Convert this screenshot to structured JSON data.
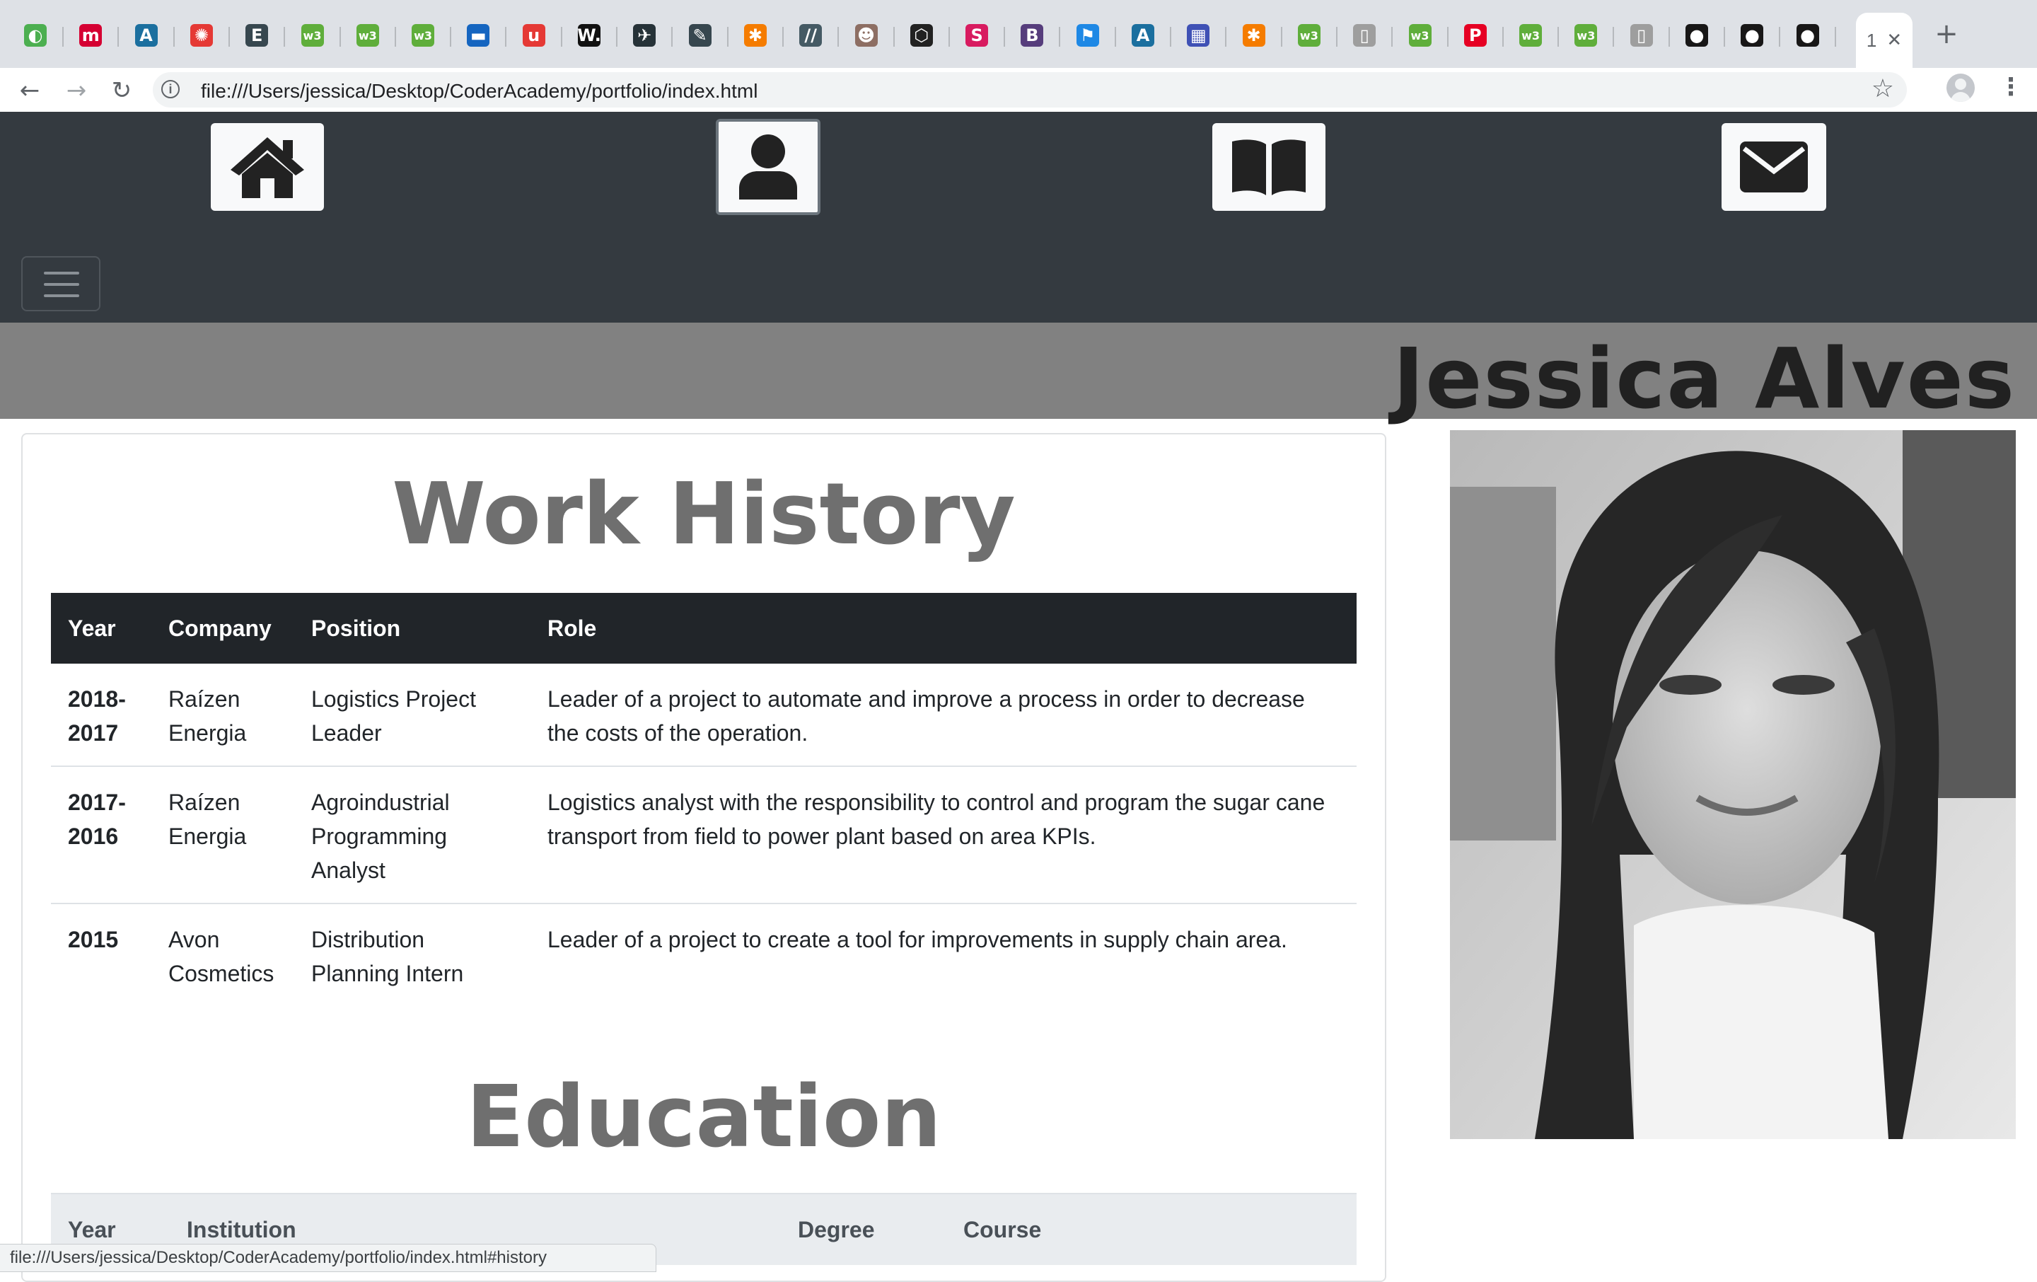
{
  "browser": {
    "tabs": [
      {
        "icon": "chrome-icon",
        "color": "#4caf50",
        "glyph": "◐"
      },
      {
        "icon": "m-logo-icon",
        "color": "#d50032",
        "glyph": "m"
      },
      {
        "icon": "a-logo-icon",
        "color": "#1b6f9f",
        "glyph": "A"
      },
      {
        "icon": "wheel-icon",
        "color": "#e53935",
        "glyph": "✺"
      },
      {
        "icon": "terminal-icon",
        "color": "#37474f",
        "glyph": "E"
      },
      {
        "icon": "w3-icon",
        "color": "#5fae3b",
        "glyph": "w3"
      },
      {
        "icon": "w3-icon",
        "color": "#5fae3b",
        "glyph": "w3"
      },
      {
        "icon": "w3-icon",
        "color": "#5fae3b",
        "glyph": "w3"
      },
      {
        "icon": "chat-icon",
        "color": "#1565c0",
        "glyph": "▬"
      },
      {
        "icon": "u-logo-icon",
        "color": "#e53935",
        "glyph": "u"
      },
      {
        "icon": "w-logo-icon",
        "color": "#111111",
        "glyph": "W."
      },
      {
        "icon": "bird-icon",
        "color": "#263238",
        "glyph": "✈"
      },
      {
        "icon": "pencil-icon",
        "color": "#37474f",
        "glyph": "✎"
      },
      {
        "icon": "asterisk-icon",
        "color": "#f57c00",
        "glyph": "✱"
      },
      {
        "icon": "slashes-icon",
        "color": "#455a64",
        "glyph": "//"
      },
      {
        "icon": "robot-icon",
        "color": "#8d6e63",
        "glyph": "☻"
      },
      {
        "icon": "codepen-icon",
        "color": "#222222",
        "glyph": "⬡"
      },
      {
        "icon": "s-logo-icon",
        "color": "#d81b60",
        "glyph": "S"
      },
      {
        "icon": "bootstrap-icon",
        "color": "#563d7c",
        "glyph": "B"
      },
      {
        "icon": "flag-icon",
        "color": "#1e88e5",
        "glyph": "⚑"
      },
      {
        "icon": "a-logo-icon",
        "color": "#1b6f9f",
        "glyph": "A"
      },
      {
        "icon": "grid-icon",
        "color": "#3f51b5",
        "glyph": "▦"
      },
      {
        "icon": "asterisk-icon",
        "color": "#f57c00",
        "glyph": "✱"
      },
      {
        "icon": "w3-icon",
        "color": "#5fae3b",
        "glyph": "w3"
      },
      {
        "icon": "file-icon",
        "color": "#9e9e9e",
        "glyph": "▯"
      },
      {
        "icon": "w3-icon",
        "color": "#5fae3b",
        "glyph": "w3"
      },
      {
        "icon": "pinterest-icon",
        "color": "#e60023",
        "glyph": "P"
      },
      {
        "icon": "w3-icon",
        "color": "#5fae3b",
        "glyph": "w3"
      },
      {
        "icon": "w3-icon",
        "color": "#5fae3b",
        "glyph": "w3"
      },
      {
        "icon": "file-icon",
        "color": "#9e9e9e",
        "glyph": "▯"
      },
      {
        "icon": "github-icon",
        "color": "#181717",
        "glyph": "●"
      },
      {
        "icon": "github-icon",
        "color": "#181717",
        "glyph": "●"
      },
      {
        "icon": "github-icon",
        "color": "#181717",
        "glyph": "●"
      }
    ],
    "active_tab_title": "1",
    "active_tab_close": "✕",
    "new_tab": "+",
    "back": "←",
    "forward": "→",
    "reload": "↻",
    "info": "i",
    "url": "file:///Users/jessica/Desktop/CoderAcademy/portfolio/index.html",
    "bookmark": "☆",
    "menu": "⋮",
    "status_url": "file:///Users/jessica/Desktop/CoderAcademy/portfolio/index.html#history"
  },
  "nav": {
    "items": [
      "home-icon",
      "user-icon",
      "book-icon",
      "envelope-icon"
    ],
    "active": "user-icon"
  },
  "banner": {
    "name": "Jessica Alves"
  },
  "work_history": {
    "title": "Work History",
    "headers": [
      "Year",
      "Company",
      "Position",
      "Role"
    ],
    "rows": [
      [
        "2018-\n2017",
        "Raízen Energia",
        "Logistics Project Leader",
        "Leader of a project to automate and improve a process in order to decrease the costs of the operation."
      ],
      [
        "2017-\n2016",
        "Raízen Energia",
        "Agroindustrial Programming Analyst",
        "Logistics analyst with the responsibility to control and program the sugar cane transport from field to power plant based on area KPIs."
      ],
      [
        "2015",
        "Avon Cosmetics",
        "Distribution Planning Intern",
        "Leader of a project to create a tool for improvements in supply chain area."
      ]
    ]
  },
  "education": {
    "title": "Education",
    "headers": [
      "Year",
      "Institution",
      "Degree",
      "Course"
    ]
  },
  "colors": {
    "nav_bg": "#343a40",
    "banner_bg": "#818181",
    "table_head_dark": "#212529",
    "table_head_light": "#e9ecef"
  }
}
